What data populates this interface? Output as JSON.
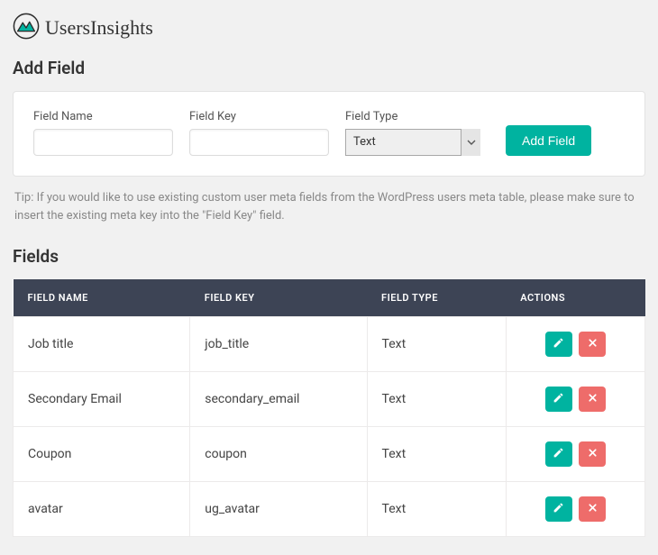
{
  "brand": "UsersInsights",
  "sections": {
    "add_field_title": "Add Field",
    "fields_title": "Fields"
  },
  "form": {
    "field_name_label": "Field Name",
    "field_name_value": "",
    "field_key_label": "Field Key",
    "field_key_value": "",
    "field_type_label": "Field Type",
    "field_type_value": "Text",
    "submit_label": "Add Field"
  },
  "tip": "Tip: If you would like to use existing custom user meta fields from the WordPress users meta table, please make sure to insert the existing meta key into the \"Field Key\" field.",
  "table": {
    "headers": {
      "name": "FIELD NAME",
      "key": "FIELD KEY",
      "type": "FIELD TYPE",
      "actions": "ACTIONS"
    },
    "rows": [
      {
        "name": "Job title",
        "key": "job_title",
        "type": "Text"
      },
      {
        "name": "Secondary Email",
        "key": "secondary_email",
        "type": "Text"
      },
      {
        "name": "Coupon",
        "key": "coupon",
        "type": "Text"
      },
      {
        "name": "avatar",
        "key": "ug_avatar",
        "type": "Text"
      }
    ]
  },
  "colors": {
    "accent": "#00b3a0",
    "danger": "#ee6c6a",
    "header_bg": "#3d4455"
  }
}
